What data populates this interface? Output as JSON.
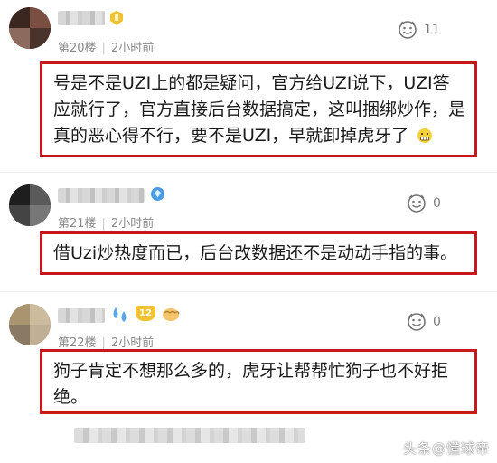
{
  "comments": [
    {
      "floor": "第20楼",
      "time": "2小时前",
      "likes": "11",
      "text": "号是不是UZI上的都是疑问，官方给UZI说下，UZI答应就行了，官方直接后台数据搞定，这叫捆绑炒作，是真的恶心得不行，要不是UZI，早就卸掉虎牙了",
      "badge_icon": "gold-level-badge-icon",
      "emoji_icon": "grimace-emoji-icon"
    },
    {
      "floor": "第21楼",
      "time": "2小时前",
      "likes": "0",
      "text": "借Uzi炒热度而已，后台改数据还不是动动手指的事。",
      "badge_icon": "blue-diamond-badge-icon"
    },
    {
      "floor": "第22楼",
      "time": "2小时前",
      "likes": "0",
      "text": "狗子肯定不想那么多的，虎牙让帮帮忙狗子也不好拒绝。",
      "badge_icons": [
        "sweat-drops-emoji-icon",
        "level-12-badge-icon",
        "fist-emoji-icon"
      ],
      "badge_level": "12"
    }
  ],
  "like_icon": "smiley-like-icon",
  "watermark": {
    "text": "头条@懂球帝",
    "icon": "toutiao-logo-icon"
  },
  "colors": {
    "highlight_border": "#c6191d",
    "meta_text": "#8a8a8a",
    "badge_gold": "#f2c230",
    "badge_blue": "#4a9be8"
  }
}
